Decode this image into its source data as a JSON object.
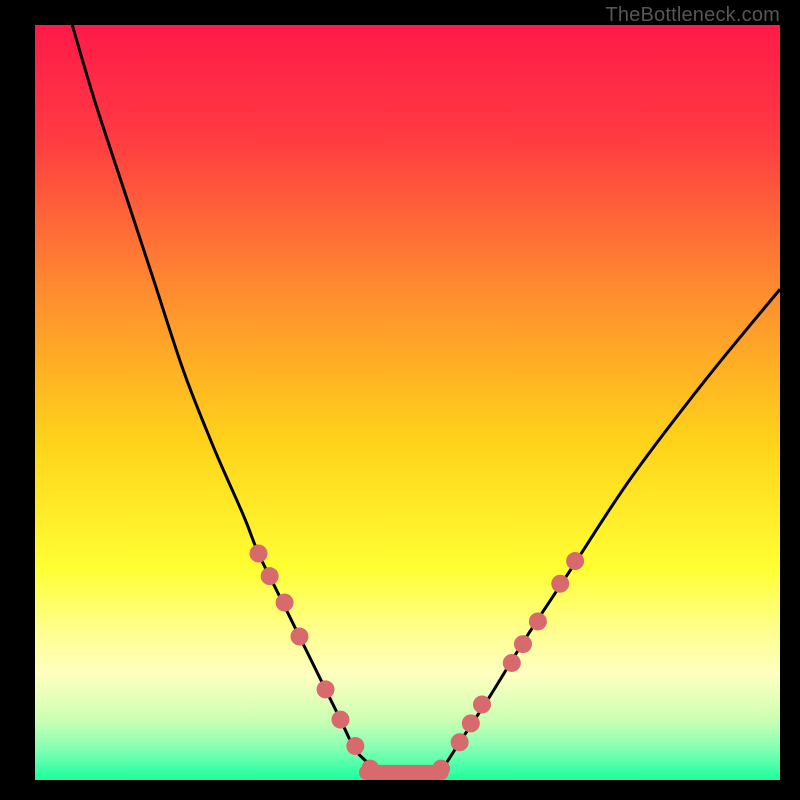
{
  "watermark": "TheBottleneck.com",
  "chart_data": {
    "type": "line",
    "title": "",
    "xlabel": "",
    "ylabel": "",
    "xlim": [
      0,
      100
    ],
    "ylim": [
      0,
      100
    ],
    "background_gradient": {
      "stops": [
        {
          "offset": 0.0,
          "color": "#ff1a49"
        },
        {
          "offset": 0.15,
          "color": "#ff3b42"
        },
        {
          "offset": 0.35,
          "color": "#ff8b30"
        },
        {
          "offset": 0.55,
          "color": "#ffd21a"
        },
        {
          "offset": 0.72,
          "color": "#ffff33"
        },
        {
          "offset": 0.8,
          "color": "#ffff8c"
        },
        {
          "offset": 0.86,
          "color": "#ffffc0"
        },
        {
          "offset": 0.92,
          "color": "#ccffb3"
        },
        {
          "offset": 0.96,
          "color": "#80ffb3"
        },
        {
          "offset": 1.0,
          "color": "#1aff9e"
        }
      ]
    },
    "series": [
      {
        "name": "bottleneck-curve",
        "x": [
          5,
          8,
          12,
          16,
          20,
          24,
          28,
          30,
          33,
          36,
          39,
          41,
          43,
          45,
          47,
          50,
          53,
          55,
          57,
          61,
          66,
          72,
          80,
          90,
          100
        ],
        "y": [
          100,
          90,
          78,
          66,
          54,
          44,
          35,
          30,
          24,
          18,
          12,
          8,
          4,
          2,
          0,
          0,
          0,
          2,
          5,
          11,
          19,
          28,
          40,
          53,
          65
        ]
      }
    ],
    "markers": {
      "color": "#d86a6e",
      "radius_px": 9,
      "points": [
        {
          "x": 30.0,
          "y": 30.0
        },
        {
          "x": 31.5,
          "y": 27.0
        },
        {
          "x": 33.5,
          "y": 23.5
        },
        {
          "x": 35.5,
          "y": 19.0
        },
        {
          "x": 39.0,
          "y": 12.0
        },
        {
          "x": 41.0,
          "y": 8.0
        },
        {
          "x": 43.0,
          "y": 4.5
        },
        {
          "x": 45.0,
          "y": 1.5
        },
        {
          "x": 47.0,
          "y": 0.5
        },
        {
          "x": 49.0,
          "y": 0.0
        },
        {
          "x": 51.0,
          "y": 0.0
        },
        {
          "x": 53.0,
          "y": 0.5
        },
        {
          "x": 54.5,
          "y": 1.5
        },
        {
          "x": 57.0,
          "y": 5.0
        },
        {
          "x": 58.5,
          "y": 7.5
        },
        {
          "x": 60.0,
          "y": 10.0
        },
        {
          "x": 64.0,
          "y": 15.5
        },
        {
          "x": 65.5,
          "y": 18.0
        },
        {
          "x": 67.5,
          "y": 21.0
        },
        {
          "x": 70.5,
          "y": 26.0
        },
        {
          "x": 72.5,
          "y": 29.0
        }
      ]
    },
    "bottom_band": {
      "color": "#d86a6e",
      "x_start": 44.5,
      "x_end": 54.5,
      "thickness_pct": 2.0
    }
  }
}
